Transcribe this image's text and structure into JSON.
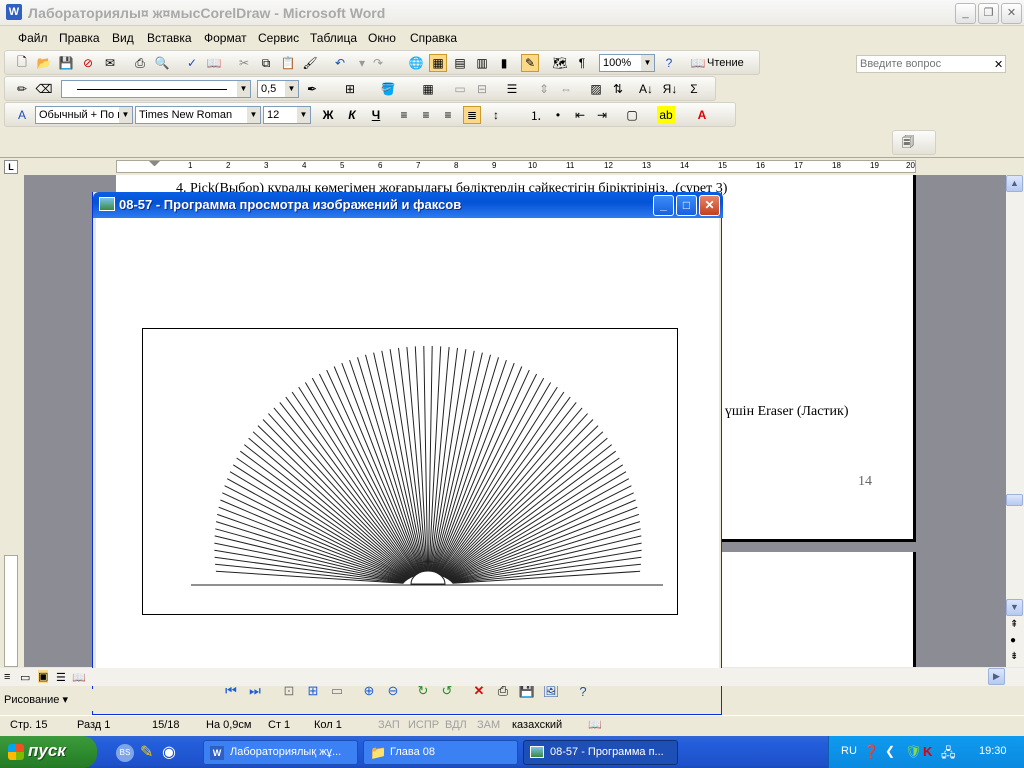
{
  "word": {
    "title": "Лабораториялы¤ ж¤мысCorelDraw - Microsoft Word",
    "menu": [
      "Файл",
      "Правка",
      "Вид",
      "Вставка",
      "Формат",
      "Сервис",
      "Таблица",
      "Окно",
      "Справка"
    ],
    "question_placeholder": "Введите вопрос",
    "zoom": "100%",
    "reading_label": "Чтение",
    "line_weight": "0,5",
    "style": "Обычный + По ц",
    "font": "Times New Roman",
    "font_size": "12",
    "ruler_numbers": [
      "1",
      "2",
      "3",
      "4",
      "5",
      "6",
      "7",
      "8",
      "9",
      "10",
      "11",
      "12",
      "13",
      "14",
      "15",
      "16",
      "17",
      "18",
      "19",
      "20"
    ],
    "doc_line_top": "4.  Pick(Выбор) құралы көмегімен жоғарыдағы бөліктердің сәйкестігін біріктіріңіз. .(сурет 3)",
    "doc_line_eraser": "ы үшін Eraser (Ластик)",
    "page_number": "14",
    "drawing_label": "Рисование"
  },
  "viewer": {
    "title": "08-57 - Программа просмотра изображений и факсов",
    "image": {
      "ray_count": 90
    }
  },
  "status": {
    "page": "Стр. 15",
    "section": "Разд 1",
    "pages": "15/18",
    "at": "На 0,9см",
    "line": "Ст 1",
    "col": "Кол 1",
    "rec": "ЗАП",
    "trk": "ИСПР",
    "ext": "ВДЛ",
    "ovr": "ЗАМ",
    "lang": "казахский"
  },
  "taskbar": {
    "start": "пуск",
    "tasks": [
      "Лабораториялық жұ...",
      "Глава 08",
      "08-57 - Программа п..."
    ],
    "lang": "RU",
    "time": "19:30"
  }
}
